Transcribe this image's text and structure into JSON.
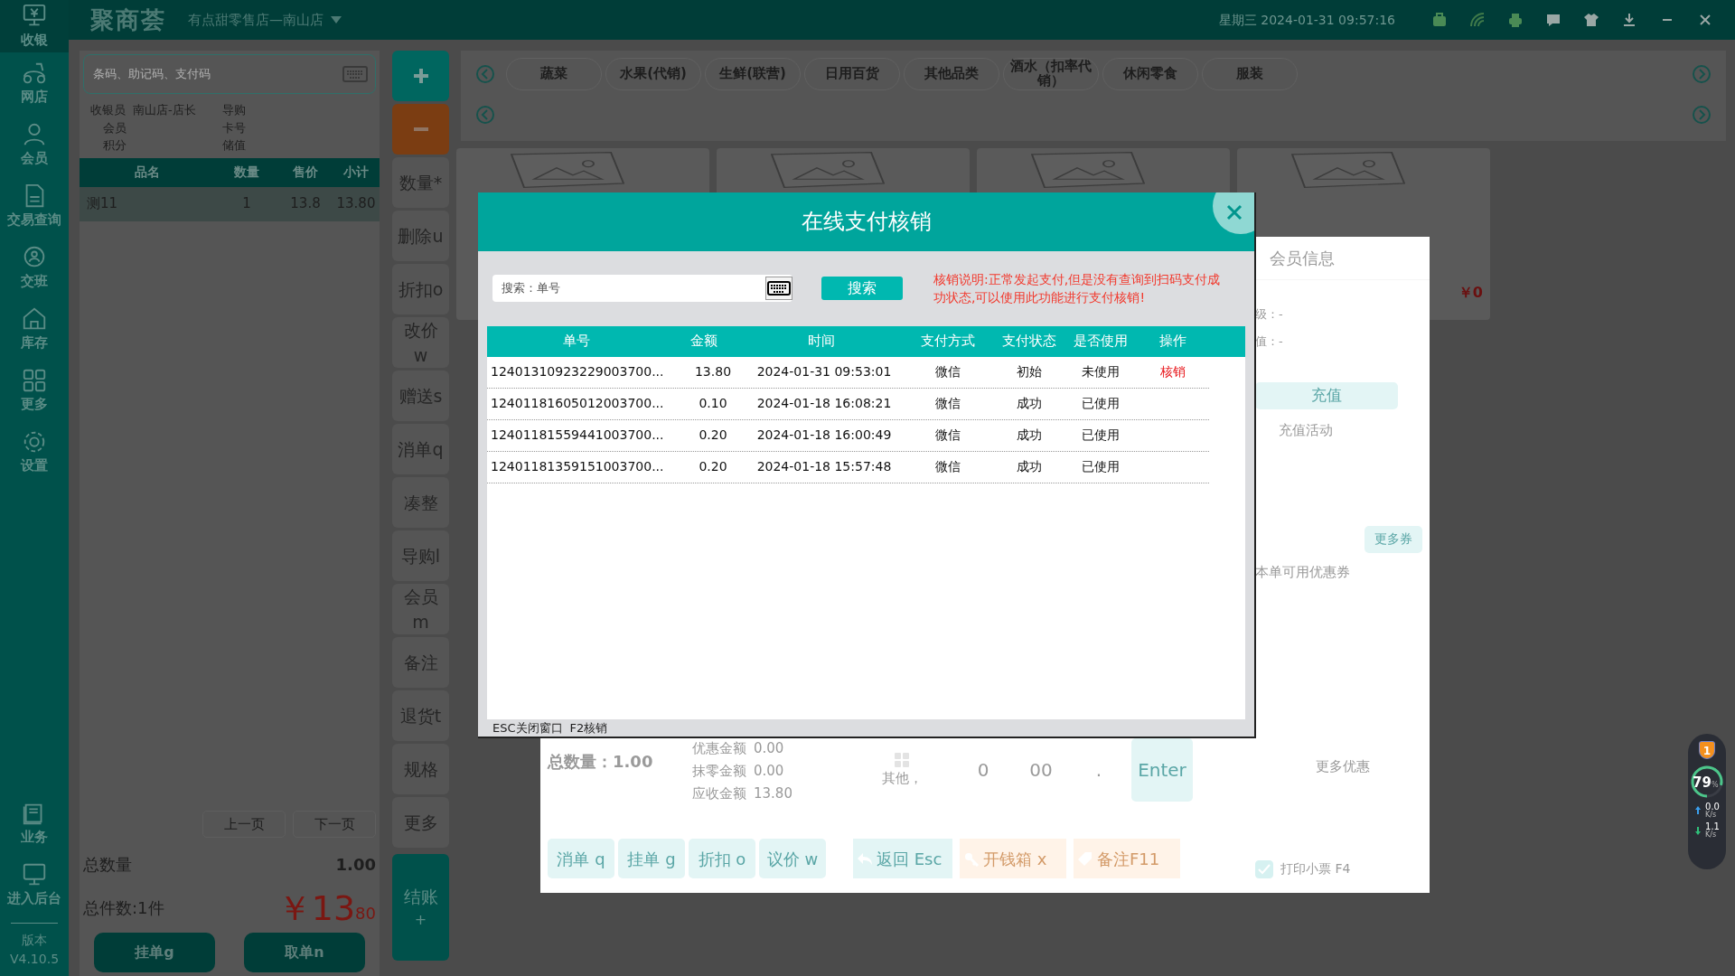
{
  "sidebar": {
    "items": [
      {
        "label": "收银",
        "selected": true
      },
      {
        "label": "网店",
        "selected": false
      },
      {
        "label": "会员",
        "selected": false
      },
      {
        "label": "交易查询",
        "selected": false
      },
      {
        "label": "交班",
        "selected": false
      },
      {
        "label": "库存",
        "selected": false
      },
      {
        "label": "更多",
        "selected": false
      },
      {
        "label": "设置",
        "selected": false
      }
    ],
    "bottom_items": [
      {
        "label": "业务"
      },
      {
        "label": "进入后台"
      }
    ],
    "version_label": "版本",
    "version": "V4.10.5"
  },
  "top_bar": {
    "logo": "聚商荟",
    "store": "有点甜零售店—南山店",
    "datetime": "星期三 2024-01-31 09:57:16"
  },
  "cart": {
    "search_placeholder": "条码、助记码、支付码",
    "info": [
      {
        "label": "收银员",
        "value": "南山店-店长"
      },
      {
        "label": "导购"
      },
      {
        "label": "会员"
      },
      {
        "label": "卡号"
      },
      {
        "label": "积分"
      },
      {
        "label": "储值"
      }
    ],
    "columns": [
      "品名",
      "数量",
      "售价",
      "小计"
    ],
    "rows": [
      {
        "cells": [
          "测11",
          "1",
          "13.8",
          "13.80"
        ],
        "selected": true
      }
    ],
    "pager": [
      "上一页",
      "下一页"
    ],
    "total_qty_label": "总数量",
    "total_qty": "1.00",
    "count": "总件数:1件",
    "price_main": "￥13",
    "price_cents": "80",
    "buttons": [
      "挂单g",
      "取单n"
    ]
  },
  "actions": {
    "items": [
      "数量*",
      "删除u",
      "折扣o",
      "改价w",
      "赠送s",
      "消单q",
      "凑整",
      "导购l",
      "会员m",
      "备注",
      "退货t",
      "规格",
      "更多"
    ],
    "checkout": "结账",
    "checkout_key": "+"
  },
  "categories": {
    "tabs": [
      "蔬菜",
      "水果(代销)",
      "生鲜(联营)",
      "日用百货",
      "其他品类",
      "酒水（扣率代销）",
      "休闲零食",
      "服装"
    ]
  },
  "product_cards": [
    {
      "kind": "image"
    },
    {
      "kind": "image"
    },
    {
      "kind": "image"
    },
    {
      "kind": "image",
      "price": "￥0"
    }
  ],
  "member_panel": {
    "title": "会员信息",
    "fields": [
      "级：-",
      "值：-"
    ],
    "recharge": "充值",
    "recharge_activity": "充值活动",
    "more_coupons": "更多券",
    "coupons_title": "本单可用优惠券",
    "more_offers": "更多优惠",
    "print_receipt": {
      "label": "打印小票 F4",
      "checked": true
    }
  },
  "checkout_panel": {
    "total": "总数量：1.00",
    "amounts": [
      {
        "label": "优惠金额",
        "value": "0.00"
      },
      {
        "label": "抹零金额",
        "value": "0.00"
      },
      {
        "label": "应收金额",
        "value": "13.80"
      }
    ],
    "keys": [
      {
        "kind": "other",
        "label": "其他，"
      },
      {
        "kind": "digit",
        "label": "0"
      },
      {
        "kind": "digit",
        "label": "00"
      },
      {
        "kind": "digit",
        "label": "."
      },
      {
        "kind": "enter",
        "label": "Enter"
      }
    ],
    "buttons": [
      "消单 q",
      "挂单 g",
      "折扣 o",
      "议价 w"
    ],
    "actions": [
      {
        "kind": "back",
        "label": "返回 Esc"
      },
      {
        "kind": "drawer",
        "label": "开钱箱 x"
      },
      {
        "kind": "note",
        "label": "备注F11"
      }
    ]
  },
  "dialog": {
    "title": "在线支付核销",
    "search_placeholder": "搜索：单号",
    "search_button": "搜索",
    "note": "核销说明:正常发起支付,但是没有查询到扫码支付成功状态,可以使用此功能进行支付核销!",
    "columns": [
      "单号",
      "金额",
      "时间",
      "支付方式",
      "支付状态",
      "是否使用",
      "操作"
    ],
    "rows": [
      {
        "cells": [
          "12401310923229003700...",
          "13.80",
          "2024-01-31 09:53:01",
          "微信",
          "初始",
          "未使用"
        ],
        "action": "核销"
      },
      {
        "cells": [
          "12401181605012003700...",
          "0.10",
          "2024-01-18 16:08:21",
          "微信",
          "成功",
          "已使用"
        ]
      },
      {
        "cells": [
          "12401181559441003700...",
          "0.20",
          "2024-01-18 16:00:49",
          "微信",
          "成功",
          "已使用"
        ]
      },
      {
        "cells": [
          "12401181359151003700...",
          "0.20",
          "2024-01-18 15:57:48",
          "微信",
          "成功",
          "已使用"
        ]
      }
    ],
    "footer": [
      "ESC关闭窗口",
      "F2核销"
    ]
  },
  "monitor_widget": {
    "badge": "1",
    "percent": "79",
    "percent_unit": "%",
    "level": 0.79,
    "upload": "0.0",
    "upload_unit": "K/s",
    "download": "1.1",
    "download_unit": "K/s"
  }
}
